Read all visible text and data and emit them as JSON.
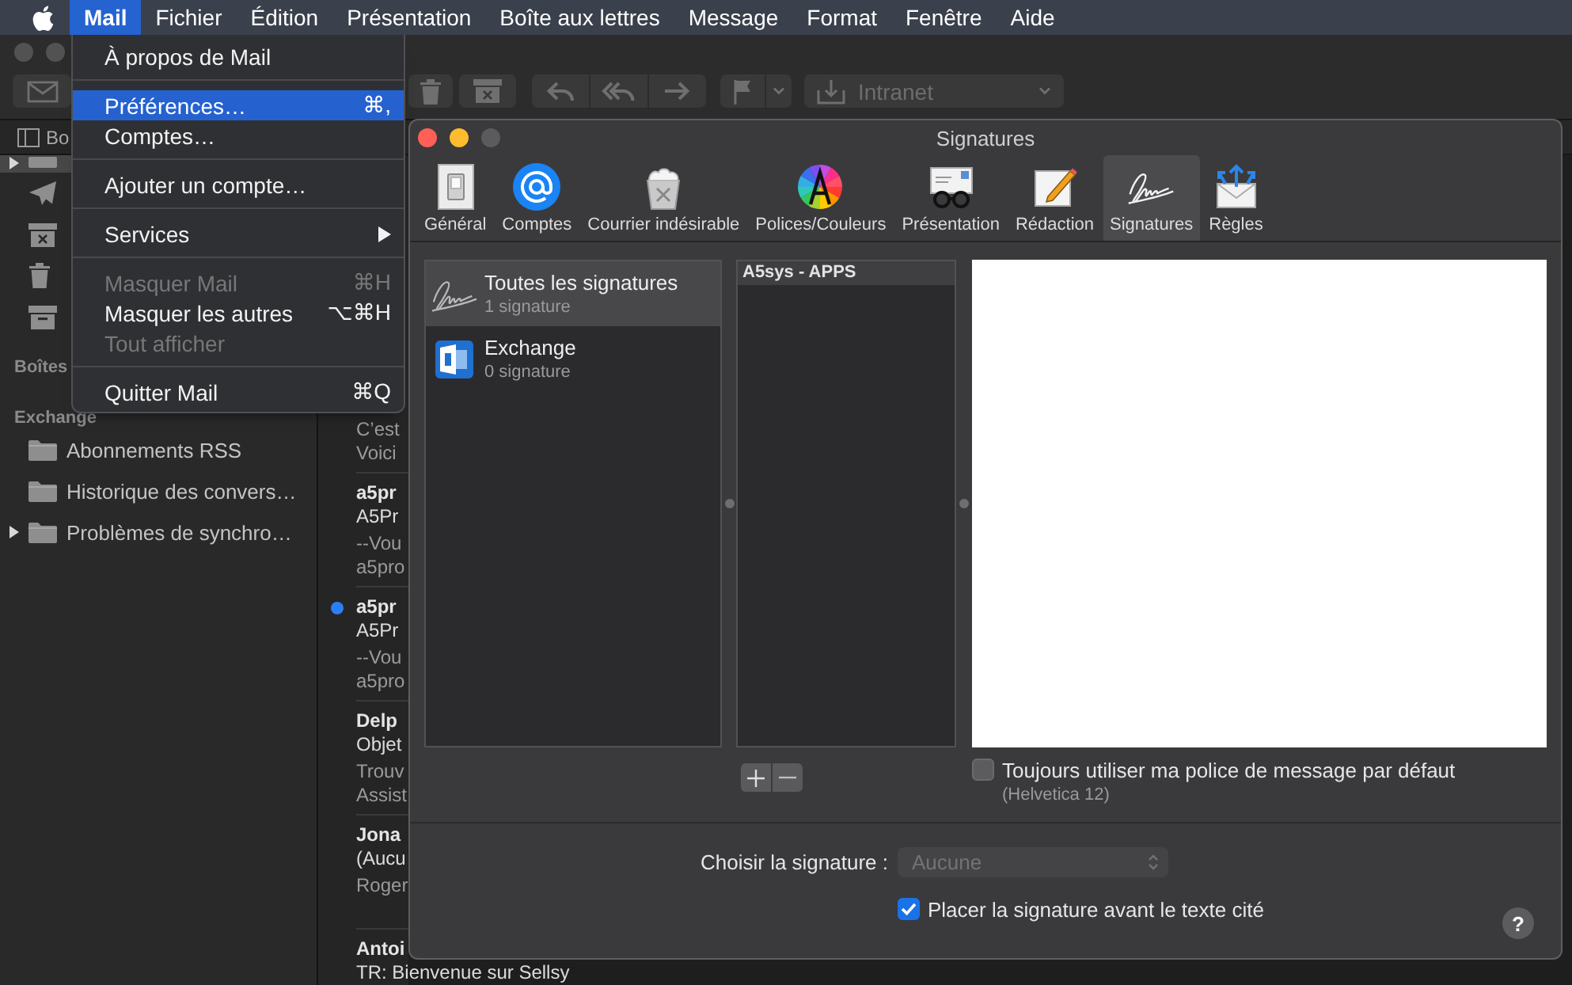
{
  "menu_bar": {
    "items": [
      {
        "kind": "app",
        "label": "Mail",
        "selected": true
      },
      {
        "kind": "menu",
        "label": "Fichier",
        "selected": false
      },
      {
        "kind": "menu",
        "label": "Édition",
        "selected": false
      },
      {
        "kind": "menu",
        "label": "Présentation",
        "selected": false
      },
      {
        "kind": "menu",
        "label": "Boîte aux lettres",
        "selected": false
      },
      {
        "kind": "menu",
        "label": "Message",
        "selected": false
      },
      {
        "kind": "menu",
        "label": "Format",
        "selected": false
      },
      {
        "kind": "menu",
        "label": "Fenêtre",
        "selected": false
      },
      {
        "kind": "menu",
        "label": "Aide",
        "selected": false
      }
    ]
  },
  "app_menu": {
    "items": [
      {
        "kind": "item",
        "label": "À propos de Mail",
        "selected": false,
        "disabled": false
      },
      {
        "kind": "separator"
      },
      {
        "kind": "item",
        "label": "Préférences…",
        "shortcut": "⌘,",
        "selected": true,
        "disabled": false
      },
      {
        "kind": "item",
        "label": "Comptes…",
        "selected": false,
        "disabled": false
      },
      {
        "kind": "separator"
      },
      {
        "kind": "item",
        "label": "Ajouter un compte…",
        "selected": false,
        "disabled": false
      },
      {
        "kind": "separator"
      },
      {
        "kind": "submenu",
        "label": "Services",
        "selected": false,
        "disabled": false
      },
      {
        "kind": "separator"
      },
      {
        "kind": "item",
        "label": "Masquer Mail",
        "shortcut": "⌘H",
        "selected": false,
        "disabled": true
      },
      {
        "kind": "item",
        "label": "Masquer les autres",
        "shortcut": "⌥⌘H",
        "selected": false,
        "disabled": false
      },
      {
        "kind": "item",
        "label": "Tout afficher",
        "selected": false,
        "disabled": true
      },
      {
        "kind": "separator"
      },
      {
        "kind": "item",
        "label": "Quitter Mail",
        "shortcut": "⌘Q",
        "selected": false,
        "disabled": false
      }
    ]
  },
  "mail_window": {
    "toolbar": {
      "move_to": "Intranet"
    },
    "favorites_bar": {
      "label": "Bo"
    },
    "sidebar": {
      "mailboxes": [
        {
          "kind": "inbox",
          "selected": true,
          "expanded": false
        },
        {
          "kind": "sent",
          "selected": false
        },
        {
          "kind": "junk",
          "selected": false
        },
        {
          "kind": "trash",
          "selected": false
        },
        {
          "kind": "archive",
          "selected": false
        }
      ],
      "section": "Boîtes",
      "account": "Exchange",
      "folders": [
        {
          "kind": "folder",
          "label": "Abonnements RSS"
        },
        {
          "kind": "folder",
          "label": "Historique des convers…"
        },
        {
          "kind": "parent",
          "label": "Problèmes de synchro…",
          "expanded": false
        }
      ]
    },
    "message_list": {
      "messages": [
        {
          "preview": [
            "C’est",
            "Voici"
          ],
          "unread": false
        },
        {
          "sender": "a5pr",
          "subject": "A5Pr",
          "preview": [
            "--Vou",
            "a5pro"
          ],
          "unread": false
        },
        {
          "sender": "a5pr",
          "subject": "A5Pr",
          "preview": [
            "--Vou",
            "a5pro"
          ],
          "unread": true
        },
        {
          "sender": "Delp",
          "subject": "Objet",
          "preview": [
            "Trouv",
            "Assist"
          ],
          "unread": false
        },
        {
          "sender": "Jona",
          "subject": "(Aucu",
          "preview": [
            "Roger"
          ],
          "unread": false
        },
        {
          "sender": "Antoi",
          "subject": "TR: Bienvenue sur Sellsy",
          "unread": false
        }
      ]
    }
  },
  "preferences": {
    "title": "Signatures",
    "tabs": [
      {
        "kind": "general",
        "label": "Général",
        "selected": false
      },
      {
        "kind": "accounts",
        "label": "Comptes",
        "selected": false
      },
      {
        "kind": "junk",
        "label": "Courrier indésirable",
        "selected": false
      },
      {
        "kind": "fonts",
        "label": "Polices/Couleurs",
        "selected": false
      },
      {
        "kind": "viewing",
        "label": "Présentation",
        "selected": false
      },
      {
        "kind": "composing",
        "label": "Rédaction",
        "selected": false
      },
      {
        "kind": "signatures",
        "label": "Signatures",
        "selected": true
      },
      {
        "kind": "rules",
        "label": "Règles",
        "selected": false
      }
    ],
    "accounts": [
      {
        "kind": "all",
        "name": "Toutes les signatures",
        "count": "1 signature",
        "selected": true
      },
      {
        "kind": "exchange",
        "name": "Exchange",
        "count": "0 signature",
        "selected": false
      }
    ],
    "signatures": [
      {
        "name": "A5sys - APPS",
        "selected": true
      }
    ],
    "default_font": {
      "label": "Toujours utiliser ma police de message par défaut",
      "note": "(Helvetica 12)",
      "checked": false
    },
    "choose_signature": {
      "label": "Choisir la signature :",
      "value": "Aucune",
      "disabled": true
    },
    "place_before_quote": {
      "label": "Placer la signature avant le texte cité",
      "checked": true
    },
    "help": "?"
  }
}
